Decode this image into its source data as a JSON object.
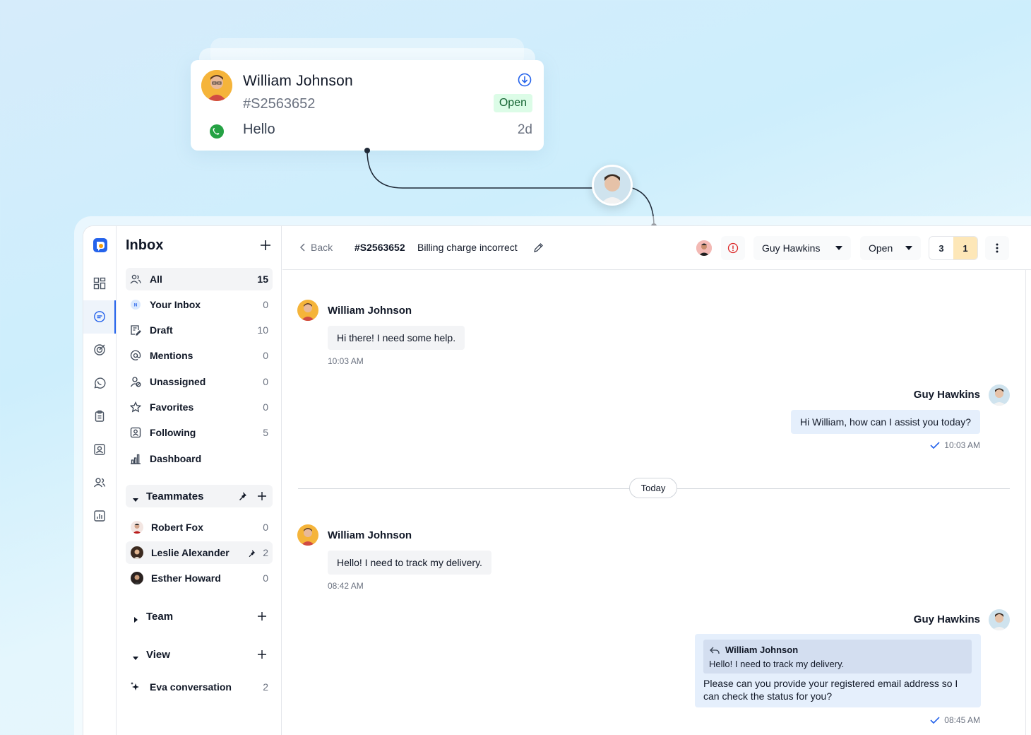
{
  "card": {
    "name": "William Johnson",
    "ticket_id": "#S2563652",
    "status": "Open",
    "message": "Hello",
    "time": "2d",
    "channel_icon": "whatsapp-icon",
    "action_icon": "download-circle-icon"
  },
  "colors": {
    "brand": "#2563eb",
    "status_open_bg": "#dcfce7",
    "status_open_text": "#166534",
    "count_highlight": "#fde7b8",
    "outgoing_bubble": "#e5effc"
  },
  "rail": {
    "icons": [
      "app-logo-icon",
      "grid-icon",
      "chat-icon",
      "target-icon",
      "whatsapp-icon",
      "clipboard-icon",
      "contact-icon",
      "users-icon",
      "report-icon"
    ]
  },
  "sidebar": {
    "title": "Inbox",
    "nav": [
      {
        "label": "All",
        "count": "15",
        "icon": "users-icon"
      },
      {
        "label": "Your Inbox",
        "count": "0",
        "icon": "avatar-n-icon"
      },
      {
        "label": "Draft",
        "count": "10",
        "icon": "draft-icon"
      },
      {
        "label": "Mentions",
        "count": "0",
        "icon": "at-icon"
      },
      {
        "label": "Unassigned",
        "count": "0",
        "icon": "unassigned-icon"
      },
      {
        "label": "Favorites",
        "count": "0",
        "icon": "star-icon"
      },
      {
        "label": "Following",
        "count": "5",
        "icon": "following-icon"
      },
      {
        "label": "Dashboard",
        "count": "",
        "icon": "chart-icon"
      }
    ],
    "teammates_label": "Teammates",
    "teammates": [
      {
        "name": "Robert Fox",
        "count": "0"
      },
      {
        "name": "Leslie Alexander",
        "count": "2"
      },
      {
        "name": "Esther Howard",
        "count": "0"
      }
    ],
    "team_label": "Team",
    "view_label": "View",
    "eva_label": "Eva conversation",
    "eva_count": "2"
  },
  "topbar": {
    "back_label": "Back",
    "ticket_id": "#S2563652",
    "subject": "Billing charge incorrect",
    "assignee": "Guy Hawkins",
    "status": "Open",
    "count_a": "3",
    "count_b": "1"
  },
  "messages": [
    {
      "sender": "William Johnson",
      "text": "Hi there! I need some help.",
      "time": "10:03 AM"
    },
    {
      "sender": "Guy Hawkins",
      "text": "Hi William, how can I assist you today?",
      "time": "10:03 AM"
    },
    {
      "sender": "William Johnson",
      "text": "Hello! I need to track my delivery.",
      "time": "08:42 AM"
    },
    {
      "sender": "Guy Hawkins",
      "quote_name": "William Johnson",
      "quote_text": "Hello! I need to track my delivery.",
      "text": "Please can you provide your registered email address so I can check the status for you?",
      "time": "08:45 AM"
    }
  ],
  "divider_label": "Today"
}
